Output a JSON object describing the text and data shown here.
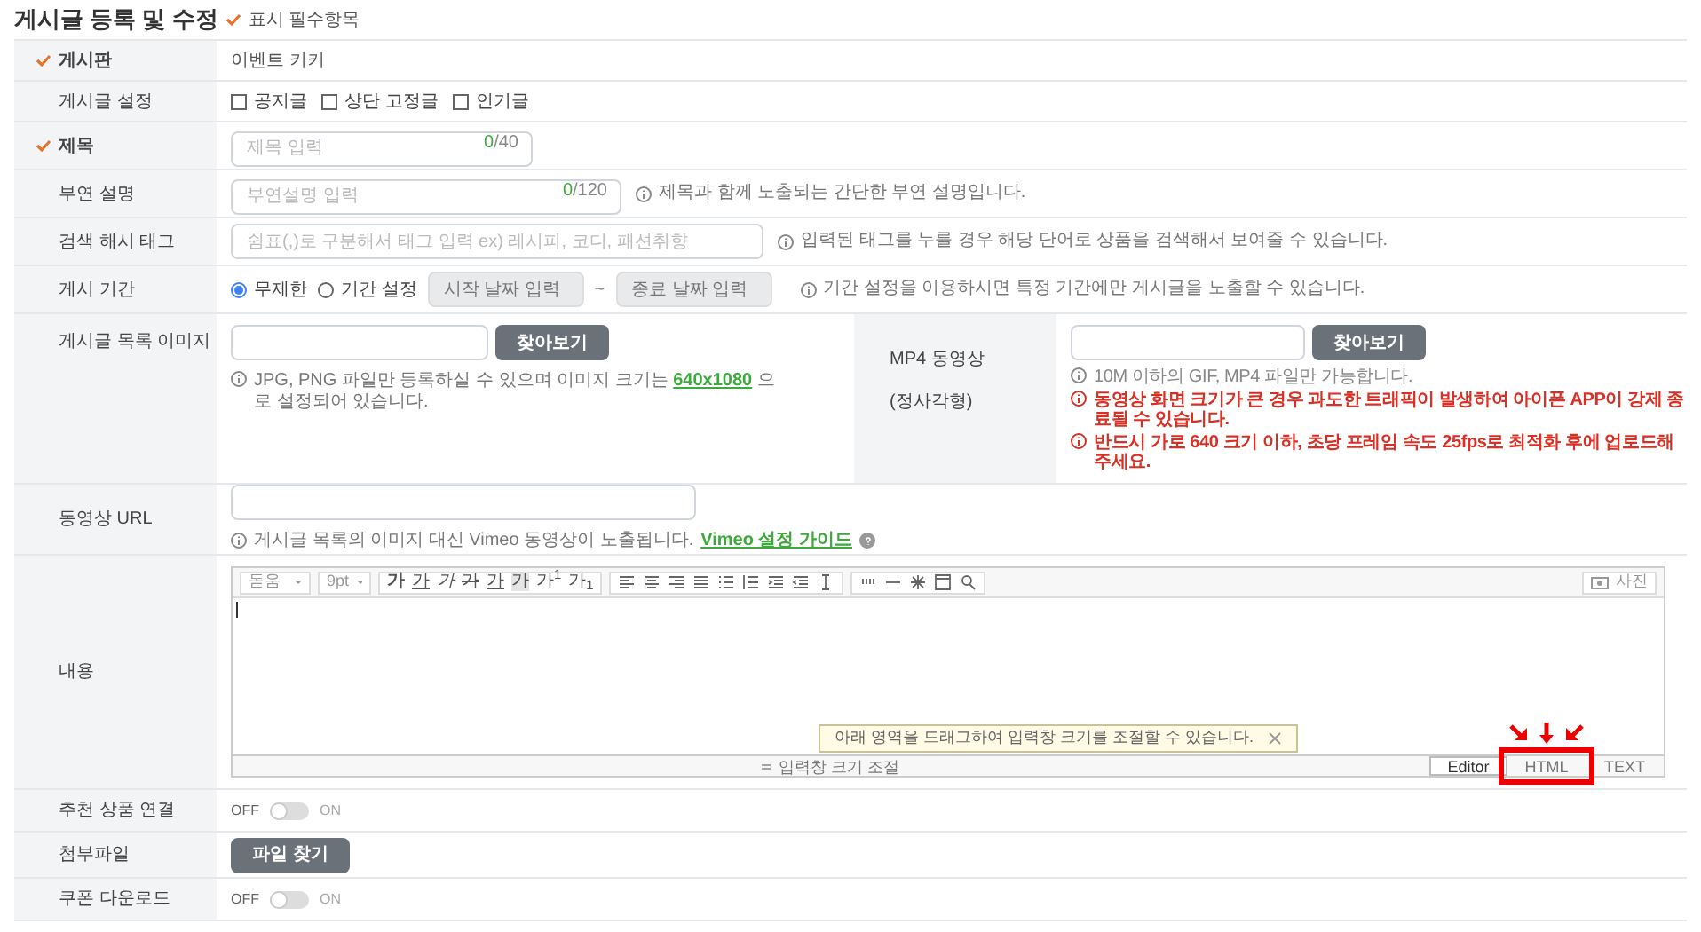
{
  "header": {
    "title": "게시글 등록 및 수정",
    "legend": "표시 필수항목"
  },
  "rows": [
    {
      "kind": "text",
      "label": "게시판",
      "required": true,
      "value": "이벤트 키키"
    },
    {
      "kind": "checkboxes",
      "label": "게시글 설정",
      "required": false,
      "options": [
        {
          "label": "공지글",
          "checked": false
        },
        {
          "label": "상단 고정글",
          "checked": false
        },
        {
          "label": "인기글",
          "checked": false
        }
      ]
    },
    {
      "kind": "counter_input",
      "label": "제목",
      "required": true,
      "placeholder": "제목 입력",
      "count": "0",
      "max": "/40"
    },
    {
      "kind": "counter_input",
      "label": "부연 설명",
      "required": false,
      "placeholder": "부연설명 입력",
      "count": "0",
      "max": "/120",
      "hint": "제목과 함께 노출되는 간단한 부연 설명입니다."
    },
    {
      "kind": "input_hint",
      "label": "검색 해시 태그",
      "required": false,
      "placeholder": "쉼표(,)로 구분해서 태그 입력 ex) 레시피, 코디, 패션취향",
      "hint": "입력된 태그를 누를 경우 해당 단어로 상품을 검색해서 보여줄 수 있습니다."
    },
    {
      "kind": "period",
      "label": "게시 기간",
      "required": false,
      "options": [
        {
          "label": "무제한",
          "selected": true
        },
        {
          "label": "기간 설정",
          "selected": false
        }
      ],
      "start_placeholder": "시작 날짜 입력",
      "separator": "~",
      "end_placeholder": "종료 날짜 입력",
      "hint": "기간 설정을 이용하시면 특정 기간에만 게시글을 노출할 수 있습니다."
    },
    {
      "kind": "image_split",
      "label": "게시글 목록 이미지",
      "required": false,
      "button": "찾아보기",
      "hint_before": "JPG, PNG 파일만 등록하실 수 있으며 이미지 크기는",
      "hint_link": "640x1080",
      "hint_after": "으로 설정되어 있습니다.",
      "side_label": "MP4 동영상\n(정사각형)",
      "side_button": "찾아보기",
      "side_notes": [
        {
          "text": "10M 이하의 GIF, MP4 파일만 가능합니다.",
          "warning": false
        },
        {
          "text": "동영상 화면 크기가 큰 경우 과도한 트래픽이 발생하여 아이폰 APP이 강제 종료될 수 있습니다.",
          "warning": true
        },
        {
          "text": "반드시 가로 640 크기 이하, 초당 프레임 속도 25fps로 최적화 후에 업로드해 주세요.",
          "warning": true
        }
      ]
    },
    {
      "kind": "url",
      "label": "동영상 URL",
      "required": false,
      "hint": "게시글 목록의 이미지 대신 Vimeo 동영상이 노출됩니다.",
      "link": "Vimeo 설정 가이드"
    },
    {
      "kind": "editor",
      "label": "내용",
      "required": false,
      "font": "돋움",
      "size": "9pt",
      "format_buttons": [
        "가",
        "가",
        "가",
        "가",
        "가",
        "가",
        "가$^{1}$",
        "가$_{1}$"
      ],
      "photo_button": "사진",
      "tooltip": "아래 영역을 드래그하여 입력창 크기를 조절할 수 있습니다.",
      "resize_label": "입력창 크기 조절",
      "modes": [
        {
          "label": "Editor",
          "selected": true,
          "highlighted": false
        },
        {
          "label": "HTML",
          "selected": false,
          "highlighted": true
        },
        {
          "label": "TEXT",
          "selected": false,
          "highlighted": false
        }
      ]
    },
    {
      "kind": "toggle",
      "label": "추천 상품 연결",
      "required": false,
      "off_label": "OFF",
      "on_label": "ON",
      "on": false
    },
    {
      "kind": "file_button",
      "label": "첨부파일",
      "required": false,
      "button": "파일 찾기"
    },
    {
      "kind": "toggle",
      "label": "쿠폰 다운로드",
      "required": false,
      "off_label": "OFF",
      "on_label": "ON",
      "on": false
    }
  ]
}
